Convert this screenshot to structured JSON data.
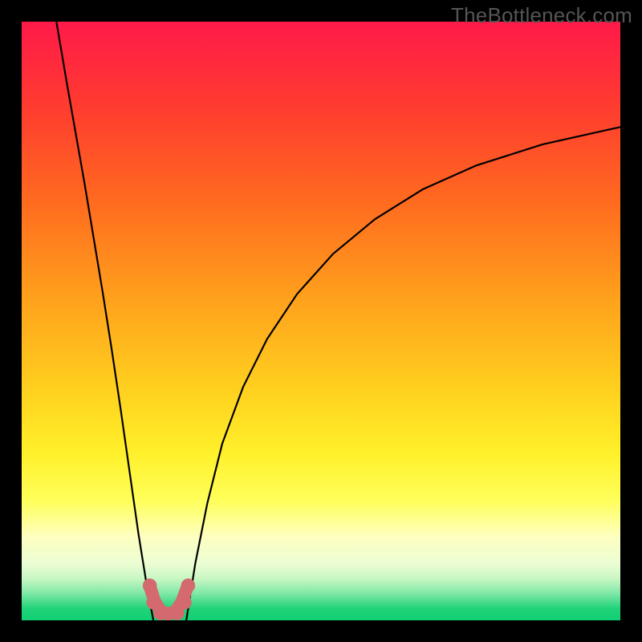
{
  "watermark": "TheBottleneck.com",
  "chart_data": {
    "type": "line",
    "title": "",
    "xlabel": "",
    "ylabel": "",
    "xlim": [
      0,
      1
    ],
    "ylim": [
      0,
      1
    ],
    "background_gradient": {
      "stops": [
        {
          "offset": 0.0,
          "color": "#ff1a49"
        },
        {
          "offset": 0.14,
          "color": "#ff3b30"
        },
        {
          "offset": 0.3,
          "color": "#ff6a1f"
        },
        {
          "offset": 0.46,
          "color": "#ffa01c"
        },
        {
          "offset": 0.62,
          "color": "#ffd21f"
        },
        {
          "offset": 0.72,
          "color": "#fff02a"
        },
        {
          "offset": 0.8,
          "color": "#ffff5a"
        },
        {
          "offset": 0.86,
          "color": "#fdffc0"
        },
        {
          "offset": 0.905,
          "color": "#ecfdd4"
        },
        {
          "offset": 0.93,
          "color": "#c9f7c4"
        },
        {
          "offset": 0.955,
          "color": "#7fe8a6"
        },
        {
          "offset": 0.98,
          "color": "#22d37a"
        },
        {
          "offset": 1.0,
          "color": "#11cf73"
        }
      ]
    },
    "series": [
      {
        "name": "left-curve",
        "color": "#000000",
        "width": 2.2,
        "x": [
          0.058,
          0.075,
          0.09,
          0.105,
          0.12,
          0.135,
          0.15,
          0.165,
          0.18,
          0.195,
          0.21,
          0.22
        ],
        "y": [
          1.0,
          0.9,
          0.815,
          0.73,
          0.64,
          0.55,
          0.455,
          0.355,
          0.25,
          0.145,
          0.052,
          0.0
        ]
      },
      {
        "name": "right-curve",
        "color": "#000000",
        "width": 2.2,
        "x": [
          0.275,
          0.29,
          0.31,
          0.335,
          0.37,
          0.41,
          0.46,
          0.52,
          0.59,
          0.67,
          0.76,
          0.87,
          1.0
        ],
        "y": [
          0.0,
          0.095,
          0.195,
          0.295,
          0.39,
          0.47,
          0.545,
          0.612,
          0.67,
          0.72,
          0.76,
          0.795,
          0.824
        ]
      },
      {
        "name": "valley-marker",
        "color": "#d46a6f",
        "width": 16,
        "linecap": "round",
        "x": [
          0.215,
          0.222,
          0.232,
          0.245,
          0.258,
          0.268,
          0.276
        ],
        "y": [
          0.054,
          0.032,
          0.016,
          0.01,
          0.016,
          0.032,
          0.054
        ]
      }
    ],
    "valley_dots": {
      "color": "#d46a6f",
      "r": 8.8,
      "points": [
        {
          "x": 0.214,
          "y": 0.058
        },
        {
          "x": 0.22,
          "y": 0.03
        },
        {
          "x": 0.232,
          "y": 0.012
        },
        {
          "x": 0.26,
          "y": 0.012
        },
        {
          "x": 0.272,
          "y": 0.03
        },
        {
          "x": 0.278,
          "y": 0.058
        }
      ]
    }
  }
}
